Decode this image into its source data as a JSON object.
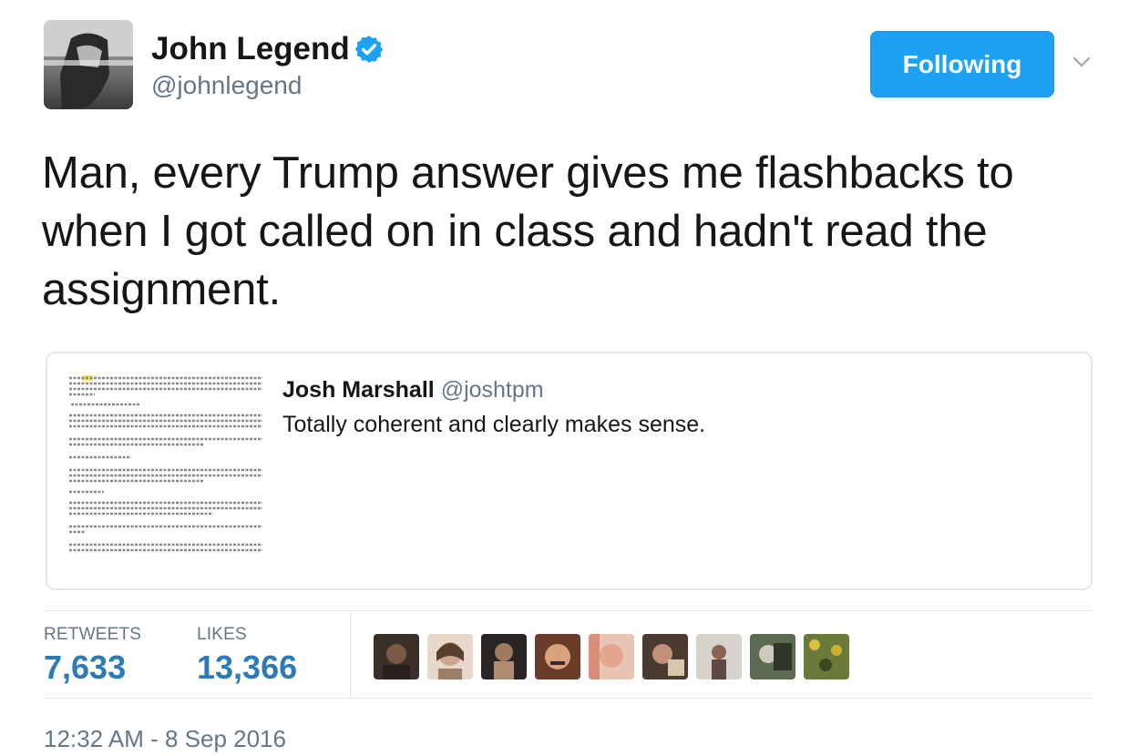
{
  "author": {
    "name": "John Legend",
    "handle": "@johnlegend",
    "verified": true
  },
  "follow_button": {
    "label": "Following",
    "color": "#1da1f2"
  },
  "tweet": {
    "text": "Man, every Trump answer gives me flashbacks to when I got called on in class and hadn't read the assignment."
  },
  "quote": {
    "author_name": "Josh Marshall",
    "author_handle": "@joshtpm",
    "text": "Totally coherent and clearly makes sense.",
    "thumbnail_icon": "document-screenshot-thumbnail"
  },
  "stats": {
    "retweets_label": "RETWEETS",
    "retweets_value": "7,633",
    "likes_label": "LIKES",
    "likes_value": "13,366",
    "value_color": "#2b7bb9"
  },
  "likers": [
    {
      "icon": "liker-avatar"
    },
    {
      "icon": "liker-avatar"
    },
    {
      "icon": "liker-avatar"
    },
    {
      "icon": "liker-avatar"
    },
    {
      "icon": "liker-avatar"
    },
    {
      "icon": "liker-avatar"
    },
    {
      "icon": "liker-avatar"
    },
    {
      "icon": "liker-avatar"
    },
    {
      "icon": "liker-avatar"
    }
  ],
  "timestamp": "12:32 AM - 8 Sep 2016"
}
